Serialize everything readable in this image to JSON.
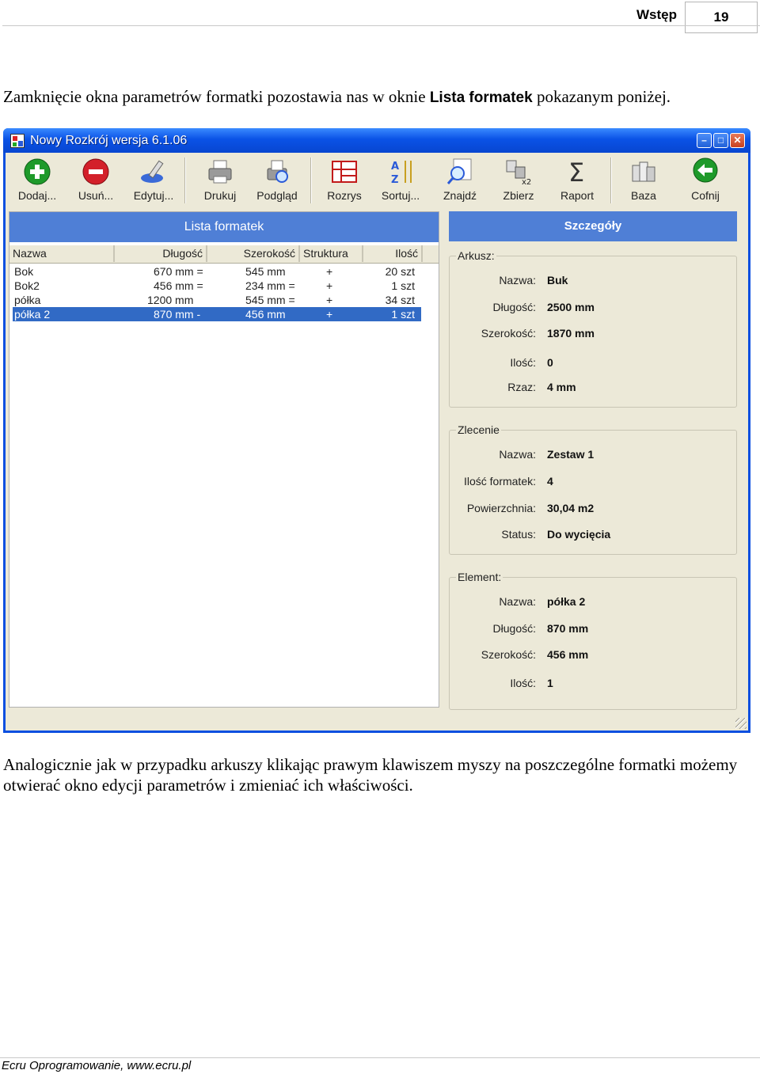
{
  "header": {
    "section": "Wstęp",
    "page_number": "19"
  },
  "intro": {
    "before": "Zamknięcie okna parametrów formatki pozostawia nas w oknie ",
    "bold": "Lista formatek",
    "after": " pokazanym poniżej."
  },
  "window": {
    "title": "Nowy Rozkrój wersja 6.1.06",
    "toolbar": [
      {
        "label": "Dodaj...",
        "icon": "add-icon"
      },
      {
        "label": "Usuń...",
        "icon": "remove-icon"
      },
      {
        "label": "Edytuj...",
        "icon": "edit-icon"
      },
      {
        "label": "Drukuj",
        "icon": "printer-icon"
      },
      {
        "label": "Podgląd",
        "icon": "preview-icon"
      },
      {
        "label": "Rozrys",
        "icon": "layout-icon"
      },
      {
        "label": "Sortuj...",
        "icon": "sort-icon"
      },
      {
        "label": "Znajdź",
        "icon": "find-icon"
      },
      {
        "label": "Zbierz",
        "icon": "collect-icon"
      },
      {
        "label": "Raport",
        "icon": "sigma-icon"
      },
      {
        "label": "Baza",
        "icon": "database-icon"
      },
      {
        "label": "Cofnij",
        "icon": "back-arrow-icon"
      }
    ],
    "list": {
      "title": "Lista formatek",
      "columns": [
        "Nazwa",
        "Długość",
        "Szerokość",
        "Struktura",
        "Ilość"
      ],
      "rows": [
        {
          "name": "Bok",
          "length": "670 mm =",
          "width": "545 mm",
          "structure": "+",
          "qty": "20 szt"
        },
        {
          "name": "Bok2",
          "length": "456 mm =",
          "width": "234 mm =",
          "structure": "+",
          "qty": "1 szt"
        },
        {
          "name": "półka",
          "length": "1200 mm",
          "width": "545 mm =",
          "structure": "+",
          "qty": "34 szt"
        },
        {
          "name": "półka 2",
          "length": "870 mm -",
          "width": "456 mm",
          "structure": "+",
          "qty": "1 szt"
        }
      ],
      "selected_row": 3
    },
    "details": {
      "title": "Szczegóły",
      "arkusz": {
        "title": "Arkusz:",
        "fields": [
          {
            "k": "Nazwa:",
            "v": "Buk"
          },
          {
            "k": "Długość:",
            "v": "2500 mm"
          },
          {
            "k": "Szerokość:",
            "v": "1870 mm"
          },
          {
            "k": "Ilość:",
            "v": "0"
          },
          {
            "k": "Rzaz:",
            "v": "4 mm"
          }
        ]
      },
      "zlecenie": {
        "title": "Zlecenie",
        "fields": [
          {
            "k": "Nazwa:",
            "v": "Zestaw 1"
          },
          {
            "k": "Ilość formatek:",
            "v": "4"
          },
          {
            "k": "Powierzchnia:",
            "v": "30,04 m2"
          },
          {
            "k": "Status:",
            "v": "Do wycięcia"
          }
        ]
      },
      "element": {
        "title": "Element:",
        "fields": [
          {
            "k": "Nazwa:",
            "v": "półka 2"
          },
          {
            "k": "Długość:",
            "v": "870 mm"
          },
          {
            "k": "Szerokość:",
            "v": "456 mm"
          },
          {
            "k": "Ilość:",
            "v": "1"
          }
        ]
      }
    }
  },
  "paragraph": "Analogicznie jak w przypadku arkuszy klikając prawym klawiszem myszy na poszczególne formatki możemy otwierać okno edycji parametrów i zmieniać ich właściwości.",
  "footer": "Ecru Oprogramowanie, www.ecru.pl"
}
